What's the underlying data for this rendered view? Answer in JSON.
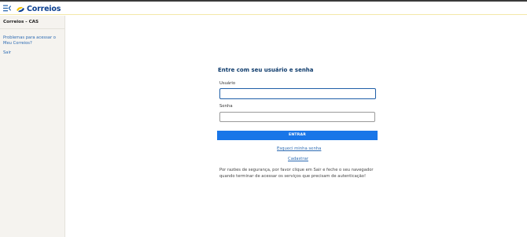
{
  "header": {
    "logo_text": "Correios",
    "brand_colors": {
      "blue": "#0b3f8f",
      "yellow": "#f5c400"
    },
    "menu_icon": "menu-collapse-icon"
  },
  "sidebar": {
    "title": "Correios - CAS",
    "links": [
      {
        "label": "Problemas para acessar o Meu Correios?"
      },
      {
        "label": "Sair"
      }
    ]
  },
  "login": {
    "title": "Entre com seu usuário e senha",
    "username_label": "Usuário",
    "username_value": "",
    "password_label": "Senha",
    "password_value": "",
    "submit_label": "ENTRAR",
    "forgot_label": "Esqueci minha senha",
    "register_label": "Cadastrar",
    "notice": "Por razões de segurança, por favor clique em Sair e feche o seu navegador quando terminar de acessar os serviços que precisam de autenticação!"
  },
  "colors": {
    "primary_button": "#1976e8",
    "link": "#2d6bb3",
    "focus_border": "#1f5fa8",
    "sidebar_bg": "#f5f3ef"
  }
}
